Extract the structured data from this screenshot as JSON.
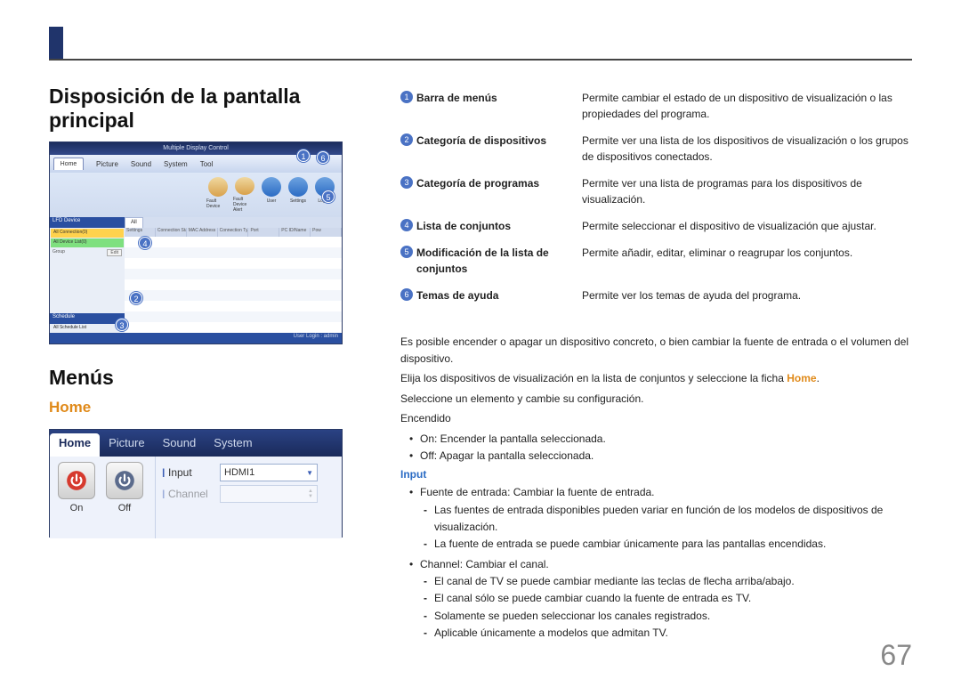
{
  "headings": {
    "h1a": "Disposición de la pantalla principal",
    "h1b": "Menús",
    "home": "Home"
  },
  "shot1": {
    "title": "Multiple Display Control",
    "menutabs": [
      "Home",
      "Picture",
      "Sound",
      "System",
      "Tool"
    ],
    "ribbon": [
      "Fault Device",
      "Fault Device Alert",
      "User",
      "Settings",
      "Logout"
    ],
    "side": {
      "lfd": "LFD Device",
      "yellow1": "All Connection(0)",
      "green": "All Device List(0)",
      "group": "Group",
      "edit": "Edit",
      "sched": "Schedule",
      "schedlist": "All Schedule List"
    },
    "gridtabs": "All",
    "gridhead": [
      "Settings",
      "Connection Status",
      "MAC Address",
      "Connection Type",
      "Port",
      "PC ID/Name",
      "Pow"
    ],
    "status": "User Login : admin"
  },
  "legend": [
    {
      "n": "1",
      "t": "Barra de menús",
      "d": "Permite cambiar el estado de un dispositivo de visualización o las propiedades del programa."
    },
    {
      "n": "2",
      "t": "Categoría de dispositivos",
      "d": "Permite ver una lista de los dispositivos de visualización o los grupos de dispositivos conectados."
    },
    {
      "n": "3",
      "t": "Categoría de programas",
      "d": "Permite ver una lista de programas para los dispositivos de visualización."
    },
    {
      "n": "4",
      "t": "Lista de conjuntos",
      "d": "Permite seleccionar el dispositivo de visualización que ajustar."
    },
    {
      "n": "5",
      "t": "Modificación de la lista de conjuntos",
      "d": "Permite añadir, editar, eliminar o reagrupar los conjuntos."
    },
    {
      "n": "6",
      "t": "Temas de ayuda",
      "d": "Permite ver los temas de ayuda del programa."
    }
  ],
  "para": {
    "p1": "Es posible encender o apagar un dispositivo concreto, o bien cambiar la fuente de entrada o el volumen del dispositivo.",
    "p2a": "Elija los dispositivos de visualización en la lista de conjuntos y seleccione la ficha ",
    "p2b": "Home",
    "p2c": ".",
    "p3": "Seleccione un elemento y cambie su configuración.",
    "p4": "Encendido",
    "on": "On",
    "on_d": ": Encender la pantalla seleccionada.",
    "off": "Off",
    "off_d": ": Apagar la pantalla seleccionada.",
    "input": "Input",
    "input_d": "Fuente de entrada: Cambiar la fuente de entrada.",
    "input_s1": "Las fuentes de entrada disponibles pueden variar en función de los modelos de dispositivos de visualización.",
    "input_s2": "La fuente de entrada se puede cambiar únicamente para las pantallas encendidas.",
    "channel": "Channel",
    "channel_d": ": Cambiar el canal.",
    "ch_s1": "El canal de TV se puede cambiar mediante las teclas de flecha arriba/abajo.",
    "ch_s2a": "El canal sólo se puede cambiar cuando la fuente de entrada es ",
    "ch_s2b": "TV",
    "ch_s2c": ".",
    "ch_s3": "Solamente se pueden seleccionar los canales registrados.",
    "ch_s4": "Aplicable únicamente a modelos que admitan TV."
  },
  "shot2": {
    "tabs": [
      "Home",
      "Picture",
      "Sound",
      "System"
    ],
    "on": "On",
    "off": "Off",
    "input_lbl": "Input",
    "input_val": "HDMI1",
    "channel_lbl": "Channel"
  },
  "pagenum": "67"
}
